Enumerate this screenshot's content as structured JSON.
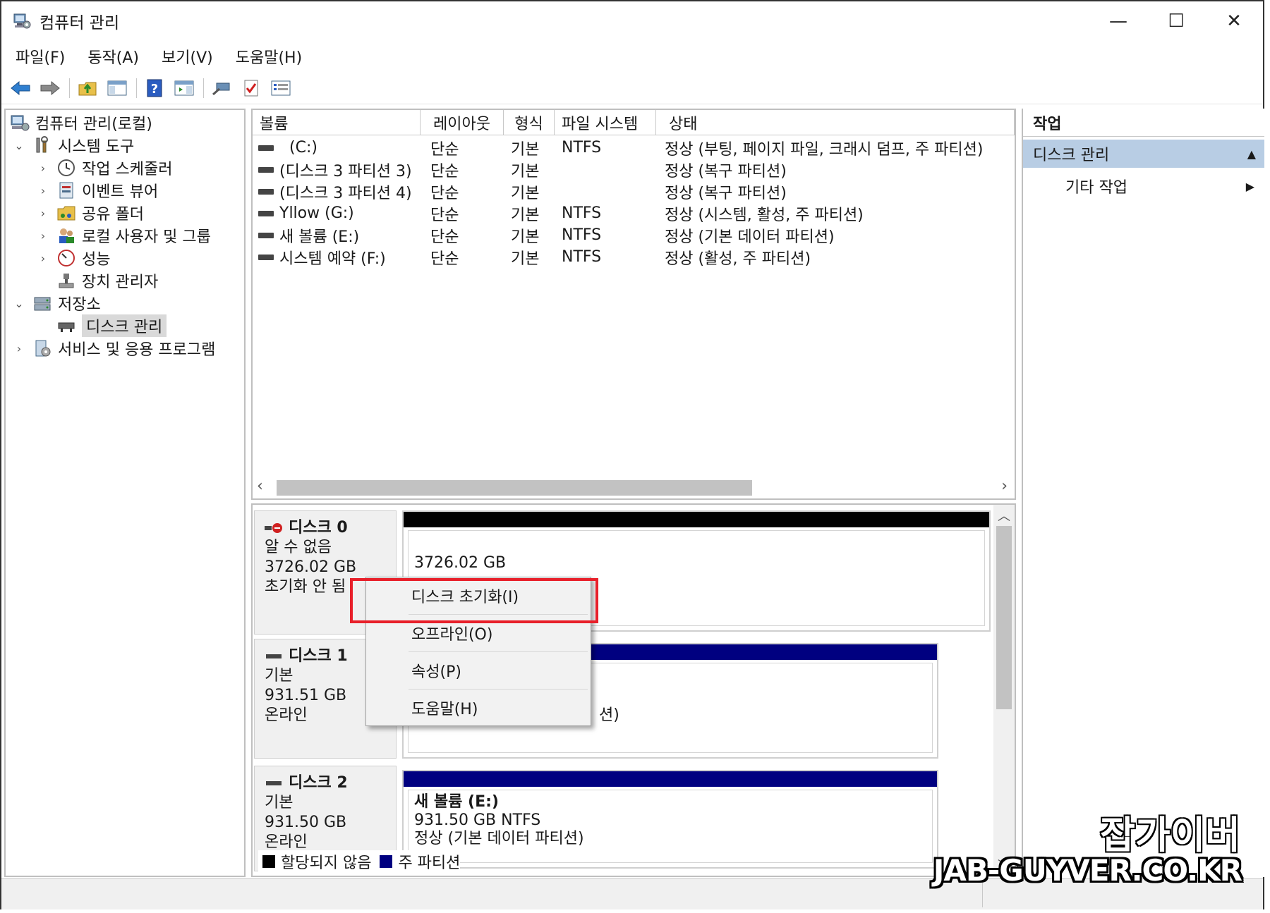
{
  "window": {
    "title": "컴퓨터 관리",
    "minimize": "—",
    "maximize": "☐",
    "close": "✕"
  },
  "menu": [
    "파일(F)",
    "동작(A)",
    "보기(V)",
    "도움말(H)"
  ],
  "tree": {
    "root": "컴퓨터 관리(로컬)",
    "system_tools": "시스템 도구",
    "task_scheduler": "작업 스케줄러",
    "event_viewer": "이벤트 뷰어",
    "shared_folders": "공유 폴더",
    "local_users": "로컬 사용자 및 그룹",
    "performance": "성능",
    "device_manager": "장치 관리자",
    "storage": "저장소",
    "disk_management": "디스크 관리",
    "services_apps": "서비스 및 응용 프로그램"
  },
  "volume_table": {
    "columns": [
      "볼륨",
      "레이아웃",
      "형식",
      "파일 시스템",
      "상태"
    ],
    "rows": [
      {
        "volume": "(C:)",
        "layout": "단순",
        "type": "기본",
        "fs": "NTFS",
        "status": "정상 (부팅, 페이지 파일, 크래시 덤프, 주 파티션)"
      },
      {
        "volume": "(디스크 3 파티션 3)",
        "layout": "단순",
        "type": "기본",
        "fs": "",
        "status": "정상 (복구 파티션)"
      },
      {
        "volume": "(디스크 3 파티션 4)",
        "layout": "단순",
        "type": "기본",
        "fs": "",
        "status": "정상 (복구 파티션)"
      },
      {
        "volume": "Yllow (G:)",
        "layout": "단순",
        "type": "기본",
        "fs": "NTFS",
        "status": "정상 (시스템, 활성, 주 파티션)"
      },
      {
        "volume": "새 볼륨 (E:)",
        "layout": "단순",
        "type": "기본",
        "fs": "NTFS",
        "status": "정상 (기본 데이터 파티션)"
      },
      {
        "volume": "시스템 예약 (F:)",
        "layout": "단순",
        "type": "기본",
        "fs": "NTFS",
        "status": "정상 (활성, 주 파티션)"
      }
    ]
  },
  "disks": [
    {
      "name": "디스크 0",
      "kind": "알 수 없음",
      "size": "3726.02 GB",
      "state": "초기화 안 됨",
      "partition_size": "3726.02 GB"
    },
    {
      "name": "디스크 1",
      "kind": "기본",
      "size": "931.51 GB",
      "state": "온라인",
      "partition_tail": "션)"
    },
    {
      "name": "디스크 2",
      "kind": "기본",
      "size": "931.50 GB",
      "state": "온라인",
      "part_name": "새 볼륨  (E:)",
      "part_size": "931.50 GB NTFS",
      "part_status": "정상 (기본 데이터 파티션)"
    }
  ],
  "legend": {
    "unallocated": "할당되지 않음",
    "primary": "주 파티션",
    "unallocated_color": "#000000",
    "primary_color": "#000080"
  },
  "actions": {
    "header": "작업",
    "section": "디스크 관리",
    "more": "기타 작업"
  },
  "context_menu": [
    "디스크 초기화(I)",
    "오프라인(O)",
    "속성(P)",
    "도움말(H)"
  ],
  "watermark": {
    "line1": "잡가이버",
    "line2": "JAB-GUYVER.CO.KR"
  },
  "colors": {
    "highlight": "#e8202a",
    "action_section": "#b8cde4",
    "partition_bar": "#000080"
  }
}
